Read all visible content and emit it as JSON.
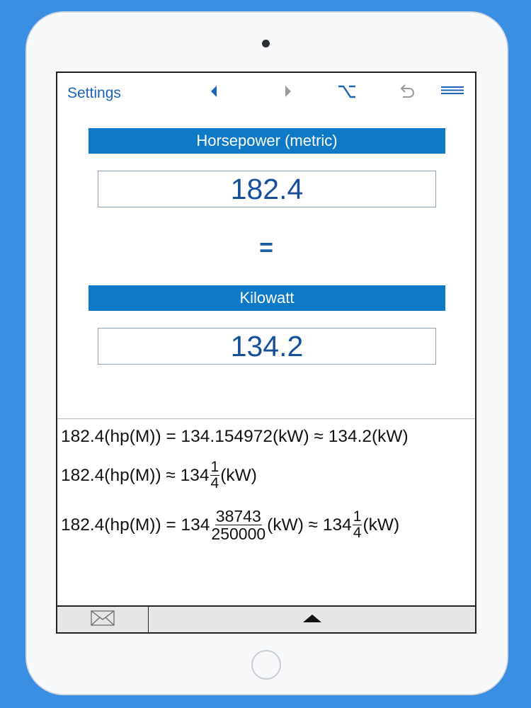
{
  "toolbar": {
    "settings_label": "Settings",
    "icons": [
      "back-arrow-icon",
      "forward-arrow-icon",
      "option-key-icon",
      "undo-icon",
      "menu-icon"
    ],
    "accent_color": "#1d63b5"
  },
  "converter": {
    "from_unit": "Horsepower (metric)",
    "from_value": "182.4",
    "equals": "=",
    "to_unit": "Kilowatt",
    "to_value": "134.2",
    "header_color": "#0e7ac7"
  },
  "results": {
    "line1": "182.4(hp(M)) = 134.154972(kW) ≈ 134.2(kW)",
    "line2": {
      "lhs": "182.4(hp(M)) ≈ 134",
      "frac_num": "1",
      "frac_den": "4",
      "unit": "(kW)"
    },
    "line3": {
      "lhs": "182.4(hp(M)) = 134",
      "frac1_num": "38743",
      "frac1_den": "250000",
      "mid": "(kW) ≈ 134",
      "frac2_num": "1",
      "frac2_den": "4",
      "unit": "(kW)"
    }
  },
  "bottom_bar": {
    "icons": [
      "mail-icon",
      "triangle-up-icon"
    ]
  },
  "colors": {
    "background": "#3a8fe3",
    "device": "#f7f8f9"
  }
}
